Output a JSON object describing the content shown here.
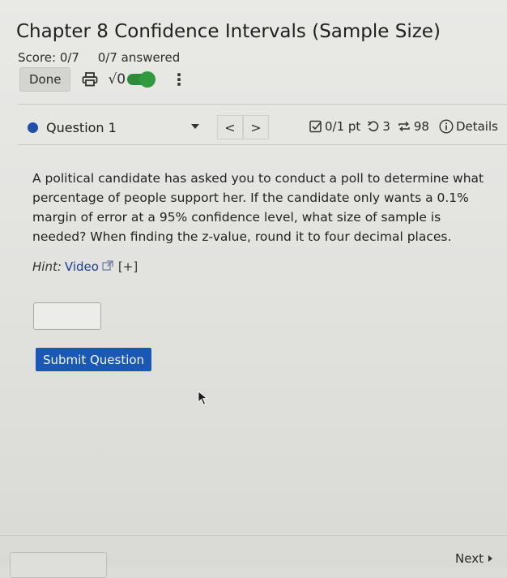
{
  "header": {
    "title": "Chapter 8 Confidence Intervals (Sample Size)",
    "score": "Score: 0/7",
    "answered": "0/7 answered"
  },
  "toolbar": {
    "done_label": "Done",
    "sqrt_label": "√0",
    "more_label": "⋮"
  },
  "question_bar": {
    "selected_question": "Question 1",
    "prev_label": "<",
    "next_label": ">",
    "points": "0/1 pt",
    "retries": "3",
    "attempts": "98",
    "details_label": "Details"
  },
  "question": {
    "text": "A political candidate has asked you to conduct a poll to determine what percentage of people support her. If the candidate only wants a 0.1% margin of error at a 95% confidence level, what size of sample is needed? When finding the z-value, round it to four decimal places.",
    "hint_label": "Hint:",
    "hint_video": "Video",
    "hint_expand": "[+]",
    "answer_value": ""
  },
  "actions": {
    "submit_label": "Submit Question"
  },
  "footer": {
    "next_label": "Next"
  },
  "colors": {
    "accent_blue": "#1a58b5",
    "toggle_green": "#2e8b3a",
    "question_dot": "#1f4fa8"
  }
}
